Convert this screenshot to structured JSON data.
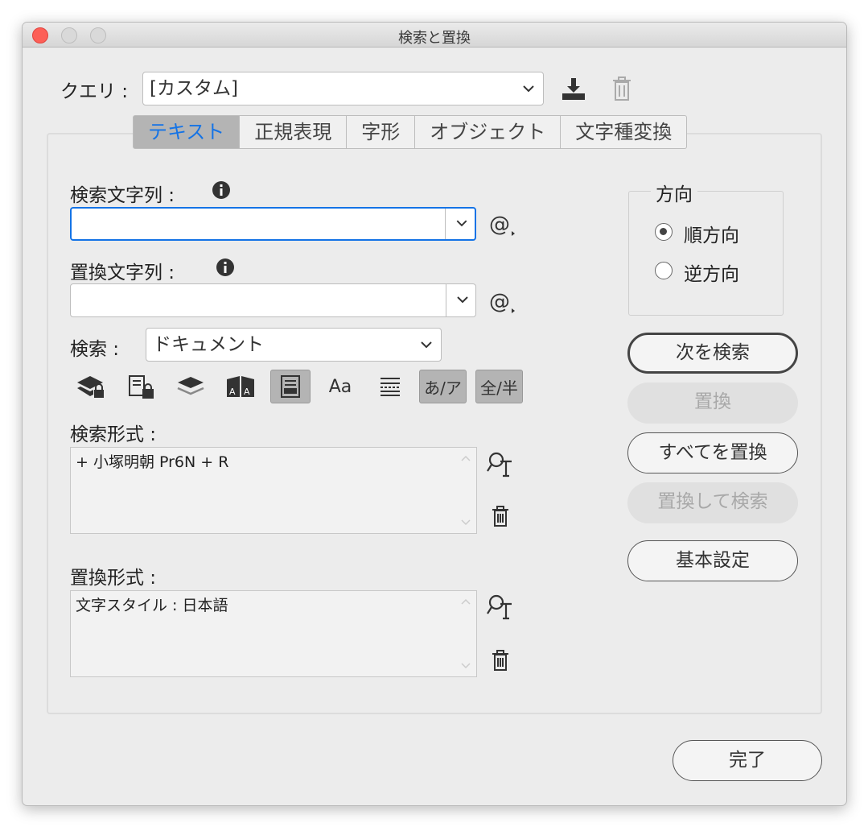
{
  "window": {
    "title": "検索と置換"
  },
  "query": {
    "label": "クエリ :",
    "value": "[カスタム]"
  },
  "tabs": [
    {
      "label": "テキスト",
      "active": true
    },
    {
      "label": "正規表現",
      "active": false
    },
    {
      "label": "字形",
      "active": false
    },
    {
      "label": "オブジェクト",
      "active": false
    },
    {
      "label": "文字種変換",
      "active": false
    }
  ],
  "find": {
    "label": "検索文字列 :",
    "value": ""
  },
  "change": {
    "label": "置換文字列 :",
    "value": ""
  },
  "search_scope": {
    "label": "検索 :",
    "value": "ドキュメント"
  },
  "toolbar": {
    "kana_label": "あ/ア",
    "width_label": "全/半",
    "case_label": "Aa"
  },
  "find_format": {
    "label": "検索形式 :",
    "value": "+ 小塚明朝 Pr6N + R"
  },
  "change_format": {
    "label": "置換形式 :",
    "value": "文字スタイル : 日本語"
  },
  "direction": {
    "label": "方向",
    "forward": "順方向",
    "backward": "逆方向",
    "selected": "forward"
  },
  "buttons": {
    "find_next": "次を検索",
    "change": "置換",
    "change_all": "すべてを置換",
    "change_find": "置換して検索",
    "more_options": "基本設定",
    "done": "完了"
  },
  "colors": {
    "accent": "#1473e6",
    "close": "#fd5f57"
  }
}
